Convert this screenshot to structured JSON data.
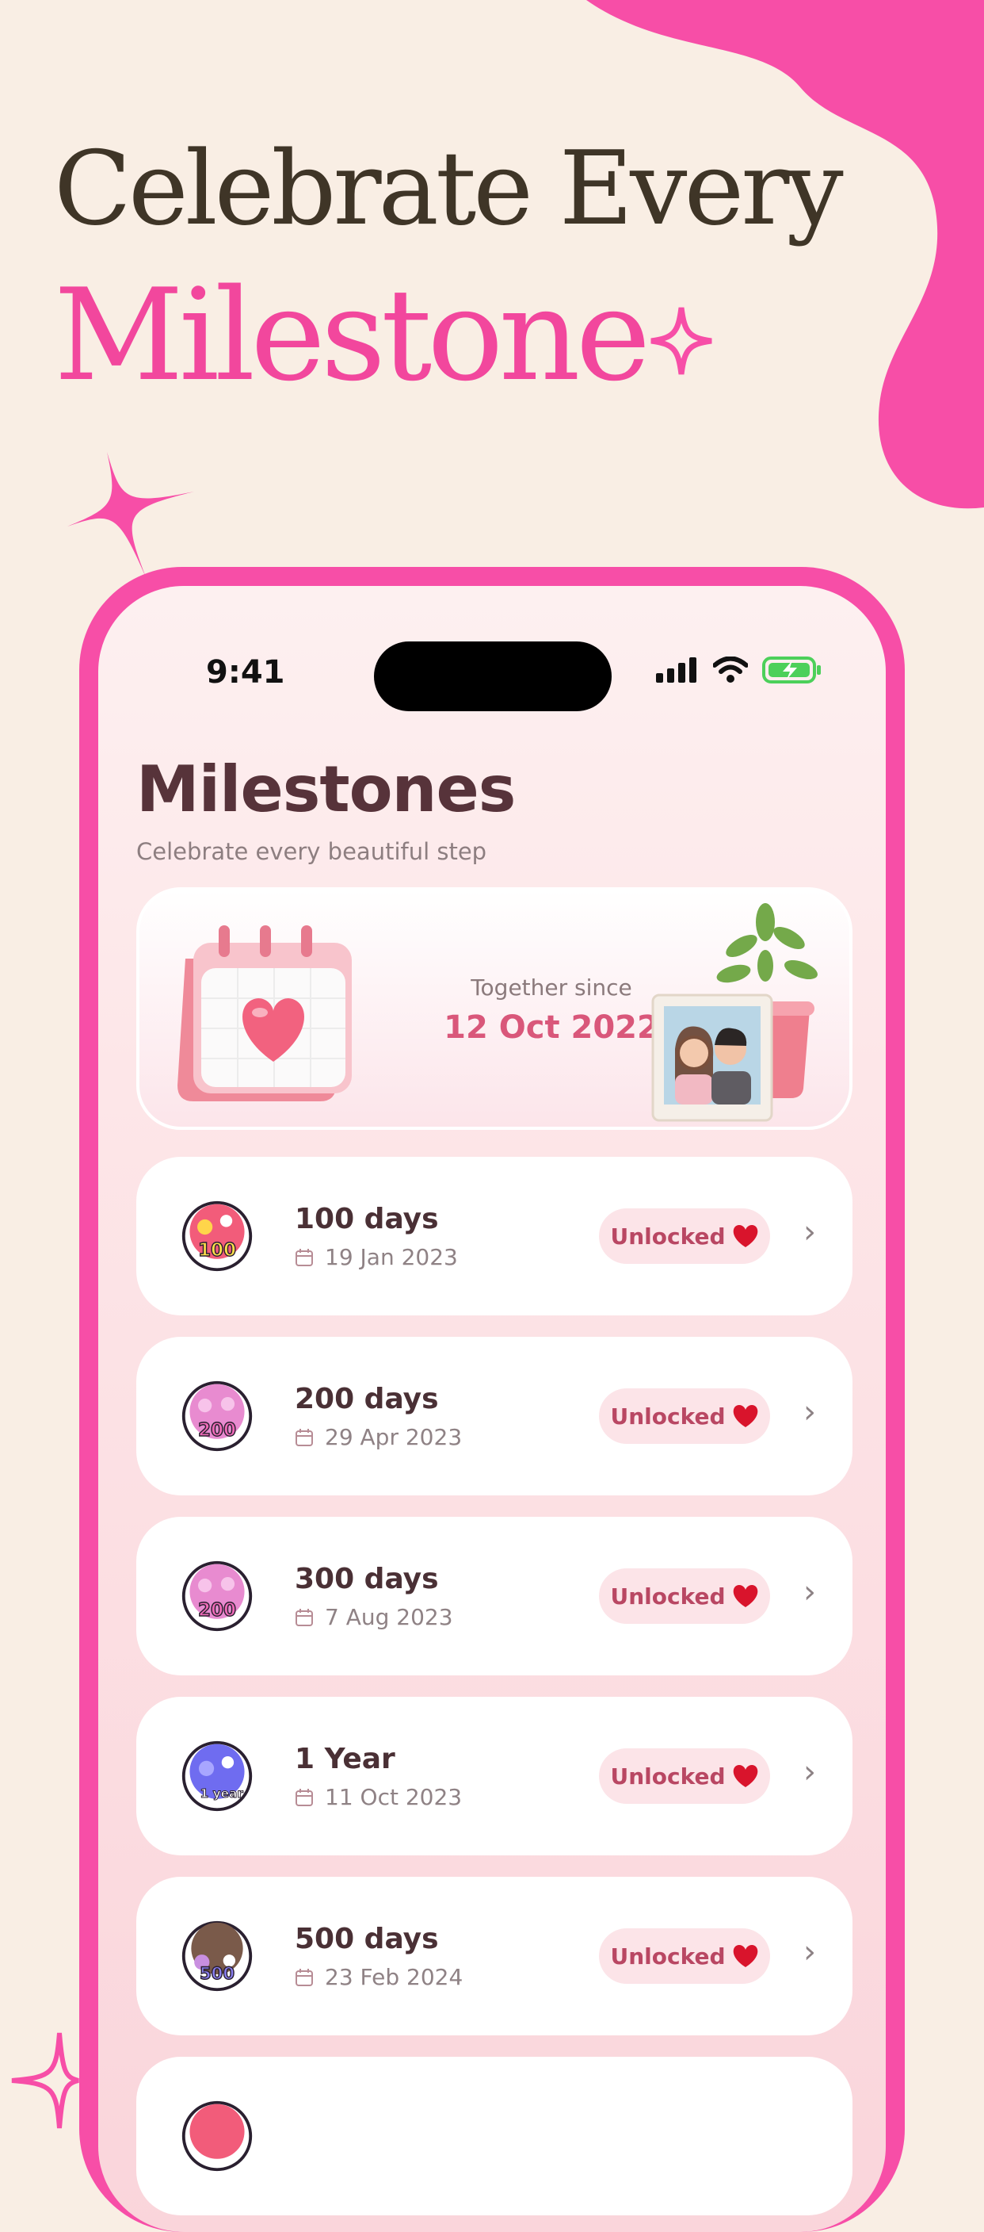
{
  "headline": {
    "line1": "Celebrate Every",
    "line2": "Milestone"
  },
  "status_bar": {
    "time": "9:41"
  },
  "page": {
    "title": "Milestones",
    "subtitle": "Celebrate every beautiful step"
  },
  "hero": {
    "label": "Together since",
    "date": "12 Oct 2022"
  },
  "milestones": [
    {
      "title": "100 days",
      "date": "19 Jan 2023",
      "status": "Unlocked",
      "badge_text": "100",
      "badge_color": "#f25c7a"
    },
    {
      "title": "200 days",
      "date": "29 Apr 2023",
      "status": "Unlocked",
      "badge_text": "200",
      "badge_color": "#e88bd0"
    },
    {
      "title": "300 days",
      "date": "7 Aug 2023",
      "status": "Unlocked",
      "badge_text": "200",
      "badge_color": "#e88bd0"
    },
    {
      "title": "1 Year",
      "date": "11 Oct 2023",
      "status": "Unlocked",
      "badge_text": "1 year",
      "badge_color": "#6f6cf0"
    },
    {
      "title": "500 days",
      "date": "23 Feb 2024",
      "status": "Unlocked",
      "badge_text": "500",
      "badge_color": "#7a5a4a"
    }
  ],
  "colors": {
    "accent": "#f74ea7",
    "title": "#57333a",
    "date": "#d9577a",
    "pill_bg": "#fce4e8"
  }
}
